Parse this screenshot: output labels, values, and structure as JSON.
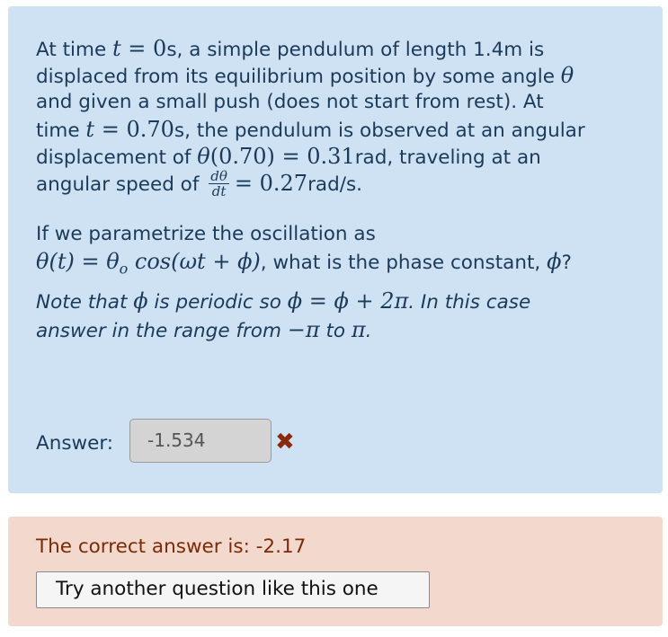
{
  "question": {
    "p1": {
      "l1": [
        "At time ",
        "t",
        " = ",
        "0",
        "s, a simple pendulum of length 1.4m is"
      ],
      "l2": [
        "displaced from its equilibrium position by some angle ",
        "θ"
      ],
      "l3": "and given a small push (does not start from rest). At",
      "l4": [
        "time ",
        "t",
        " = ",
        "0.70",
        "s, the pendulum is observed at an angular"
      ],
      "l5": [
        "displacement of ",
        "θ",
        "(0.70) = 0.31",
        "rad, traveling at an"
      ],
      "l6": [
        "angular speed of ",
        "dθ",
        "dt",
        "= 0.27",
        "rad/s."
      ]
    },
    "p2": {
      "l1": "If we parametrize the oscillation as",
      "l2": [
        "θ(t) = θ",
        "o",
        " cos(ωt + ϕ)",
        ", what is the phase constant, ",
        "ϕ",
        "?"
      ]
    },
    "p3": {
      "l1": [
        "Note that ",
        "ϕ",
        " is periodic so ",
        "ϕ = ϕ + 2π",
        ".  In this case"
      ],
      "l2": [
        "answer in the range from ",
        "−π",
        " to ",
        "π",
        "."
      ]
    }
  },
  "answer": {
    "label": "Answer:",
    "value": "-1.534",
    "status_icon": "✖"
  },
  "feedback": {
    "correct_text": "The correct answer is: -2.17",
    "retry_label": "Try another question like this one"
  },
  "colors": {
    "question_bg": "#cfe2f3",
    "feedback_bg": "#f3d9cd",
    "text": "#1b3a5a",
    "error": "#8b2a0a"
  }
}
